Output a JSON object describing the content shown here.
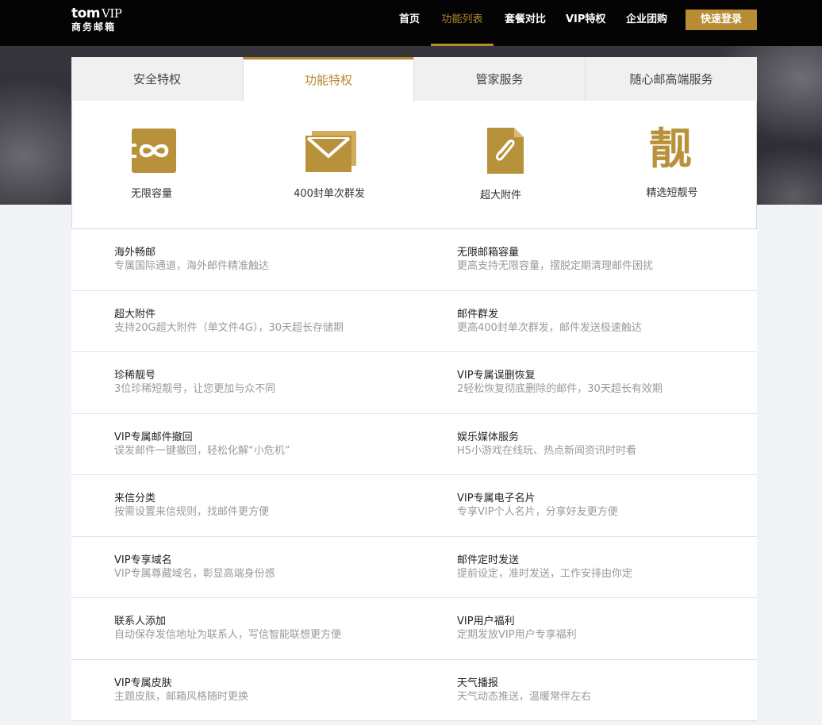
{
  "header": {
    "logo_brand": "tom",
    "logo_vip": "VIP",
    "logo_sub": "商务邮箱",
    "nav": [
      "首页",
      "功能列表",
      "套餐对比",
      "VIP特权",
      "企业团购"
    ],
    "active_nav": "功能列表",
    "login_label": "快速登录"
  },
  "tabs": [
    "安全特权",
    "功能特权",
    "管家服务",
    "随心邮高端服务"
  ],
  "active_tab": "功能特权",
  "features": [
    {
      "icon": "infinity-icon",
      "label": "无限容量"
    },
    {
      "icon": "envelope-icon",
      "label": "400封单次群发"
    },
    {
      "icon": "paperclip-icon",
      "label": "超大附件"
    },
    {
      "icon": "liang-character-icon",
      "label": "精选短靓号",
      "glyph": "靓"
    }
  ],
  "list": [
    [
      {
        "title": "海外畅邮",
        "desc": "专属国际通道，海外邮件精准触达"
      },
      {
        "title": "无限邮箱容量",
        "desc": "更高支持无限容量，摆脱定期清理邮件困扰"
      }
    ],
    [
      {
        "title": "超大附件",
        "desc": "支持20G超大附件（单文件4G），30天超长存储期"
      },
      {
        "title": "邮件群发",
        "desc": "更高400封单次群发，邮件发送极速触达"
      }
    ],
    [
      {
        "title": "珍稀靓号",
        "desc": "3位珍稀短靓号，让您更加与众不同"
      },
      {
        "title": "VIP专属误删恢复",
        "desc": "2轻松恢复彻底删除的邮件，30天超长有效期"
      }
    ],
    [
      {
        "title": "VIP专属邮件撤回",
        "desc": "误发邮件一键撤回，轻松化解“小危机”"
      },
      {
        "title": "娱乐媒体服务",
        "desc": "H5小游戏在线玩、热点新闻资讯时时看"
      }
    ],
    [
      {
        "title": "来信分类",
        "desc": "按需设置来信规则，找邮件更方便"
      },
      {
        "title": "VIP专属电子名片",
        "desc": "专享VIP个人名片，分享好友更方便"
      }
    ],
    [
      {
        "title": "VIP专享域名",
        "desc": "VIP专属尊藏域名，彰显高端身份感"
      },
      {
        "title": "邮件定时发送",
        "desc": "提前设定，准时发送，工作安排由你定"
      }
    ],
    [
      {
        "title": "联系人添加",
        "desc": "自动保存发信地址为联系人，写信智能联想更方便"
      },
      {
        "title": "VIP用户福利",
        "desc": "定期发放VIP用户专享福利"
      }
    ],
    [
      {
        "title": "VIP专属皮肤",
        "desc": "主题皮肤，邮箱风格随时更换"
      },
      {
        "title": "天气播报",
        "desc": "天气动态推送，温暖常伴左右"
      }
    ]
  ],
  "colors": {
    "accent": "#b48b2f",
    "header_bg": "#040404",
    "icon_gold": "#b8923a"
  }
}
